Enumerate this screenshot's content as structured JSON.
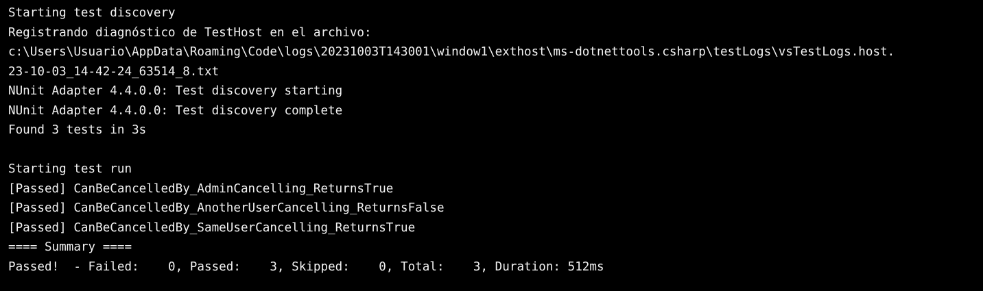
{
  "terminal": {
    "colors": {
      "background": "#000000",
      "text": "#f2f2f2"
    },
    "lines": [
      "Starting test discovery",
      "Registrando diagnóstico de TestHost en el archivo:",
      "c:\\Users\\Usuario\\AppData\\Roaming\\Code\\logs\\20231003T143001\\window1\\exthost\\ms-dotnettools.csharp\\testLogs\\vsTestLogs.host.",
      "23-10-03_14-42-24_63514_8.txt",
      "NUnit Adapter 4.4.0.0: Test discovery starting",
      "NUnit Adapter 4.4.0.0: Test discovery complete",
      "Found 3 tests in 3s",
      "",
      "Starting test run",
      "[Passed] CanBeCancelledBy_AdminCancelling_ReturnsTrue",
      "[Passed] CanBeCancelledBy_AnotherUserCancelling_ReturnsFalse",
      "[Passed] CanBeCancelledBy_SameUserCancelling_ReturnsTrue",
      "==== Summary ====",
      "Passed!  - Failed:    0, Passed:    3, Skipped:    0, Total:    3, Duration: 512ms"
    ]
  }
}
